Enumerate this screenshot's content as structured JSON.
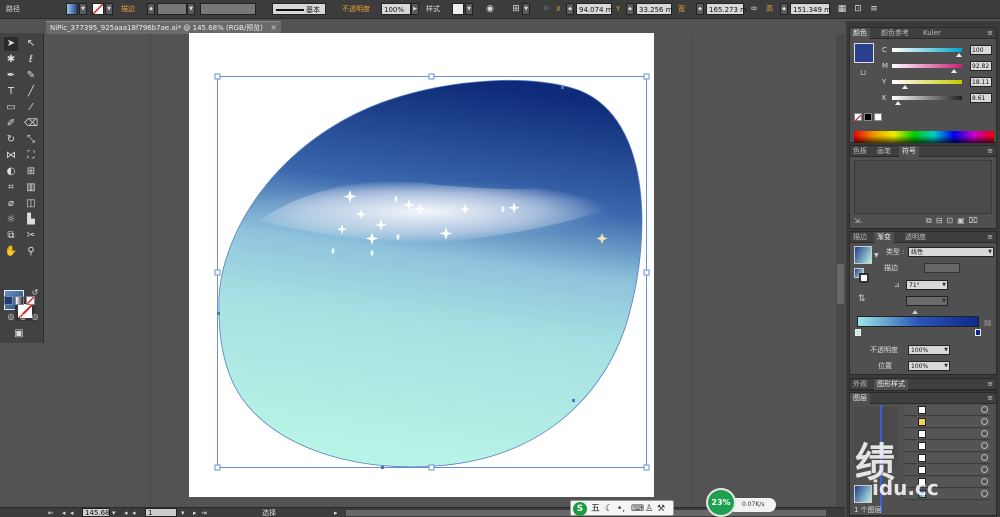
{
  "control_bar": {
    "path_label": "路径",
    "stroke_label": "描边",
    "stroke_style": "基本",
    "opacity_label": "不透明度",
    "opacity_value": "100%",
    "style_label": "样式",
    "x_label": "X",
    "x_value": "94.074 m",
    "y_label": "Y",
    "y_value": "33.256 m",
    "w_label": "宽",
    "w_value": "165.273 m",
    "h_label": "高",
    "h_value": "151.349 m"
  },
  "document": {
    "tab_title": "NiPic_377395_925aaa18f796b7ae.ai* @ 145.68% (RGB/预览)"
  },
  "status_bar": {
    "zoom": "145.68",
    "page": "1",
    "tool_status": "选择"
  },
  "color_panel": {
    "tabs": [
      "颜色",
      "颜色参考",
      "Kuler"
    ],
    "sliders": [
      {
        "label": "C",
        "value": "100",
        "frac": 0.95,
        "color": "#00a8c8"
      },
      {
        "label": "M",
        "value": "92.82",
        "frac": 0.88,
        "color": "#c8207a"
      },
      {
        "label": "Y",
        "value": "18.11",
        "frac": 0.18,
        "color": "#c8c800"
      },
      {
        "label": "K",
        "value": "8.61",
        "frac": 0.08,
        "color": "#222222"
      }
    ]
  },
  "swatches_panel": {
    "tabs": [
      "色板",
      "画笔",
      "符号"
    ]
  },
  "gradient_panel": {
    "tabs": [
      "描边",
      "渐变",
      "透明度"
    ],
    "type_label": "类型",
    "type_value": "线性",
    "stroke_label": "描边",
    "angle_value": "71°",
    "opacity_label": "不透明度",
    "opacity_value": "100%",
    "location_label": "位置",
    "location_value": "100%"
  },
  "appearance_panel": {
    "tabs": [
      "外观",
      "图形样式"
    ]
  },
  "layers_panel": {
    "tabs": [
      "图层"
    ],
    "footer": "1 个图层"
  },
  "watermark": {
    "main": "绩",
    "sub": "idu.cc"
  },
  "ime": {
    "logo": "S",
    "mode": "五"
  },
  "speed_widget": {
    "percent": "23%",
    "rate": "0.07K/s"
  },
  "colors": {
    "ui_bg": "#535353",
    "panel_bg": "#505050",
    "accent_orange": "#e8a33a",
    "fill_current": "#2b3f8c"
  }
}
